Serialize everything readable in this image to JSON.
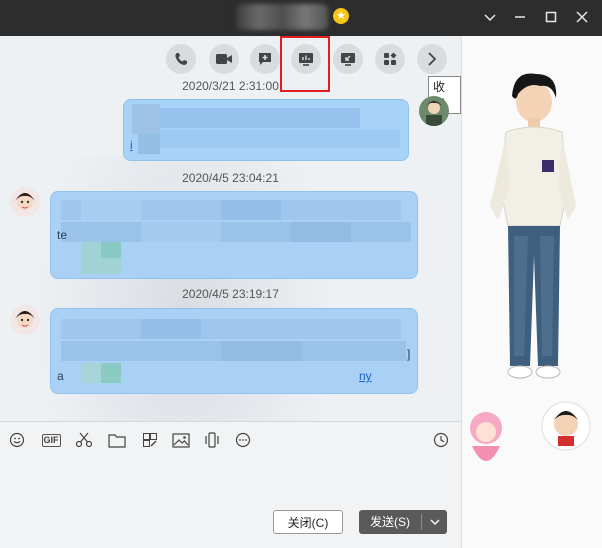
{
  "window": {
    "controls": {
      "menu_icon": "chevron-down-icon",
      "minimize_icon": "minimize-icon",
      "maximize_icon": "maximize-icon",
      "close_icon": "close-icon"
    }
  },
  "toolbar": {
    "buttons": [
      {
        "id": "voice",
        "icon": "phone-icon"
      },
      {
        "id": "video",
        "icon": "video-icon"
      },
      {
        "id": "add",
        "icon": "add-chat-icon"
      },
      {
        "id": "screen_share",
        "icon": "screen-share-icon",
        "highlighted": true
      },
      {
        "id": "remote",
        "icon": "remote-desktop-icon"
      },
      {
        "id": "apps",
        "icon": "apps-icon"
      },
      {
        "id": "more",
        "icon": "chevron-right-icon"
      }
    ],
    "tooltip": "收起",
    "highlight_color": "#e02020"
  },
  "messages": [
    {
      "timestamp": "2020/3/21 2:31:00",
      "sender": "me",
      "visible_text": "i"
    },
    {
      "timestamp": "2020/4/5 23:04:21",
      "sender": "them",
      "visible_text": "te"
    },
    {
      "timestamp": "2020/4/5 23:19:17",
      "sender": "them",
      "visible_text": "a",
      "link_fragment": "ny",
      "trailing_fragment": "]"
    }
  ],
  "input_toolbar": {
    "icons": [
      "emoji-icon",
      "gif-icon",
      "scissors-icon",
      "folder-icon",
      "image-edit-icon",
      "image-icon",
      "shake-icon",
      "more-icon",
      "history-icon"
    ],
    "gif_label": "GIF"
  },
  "actions": {
    "close_label": "关闭(C)",
    "send_label": "发送(S)"
  },
  "colors": {
    "titlebar": "#2d2d2d",
    "bubble": "#a8d2f7",
    "send_button": "#5a5a5a"
  }
}
